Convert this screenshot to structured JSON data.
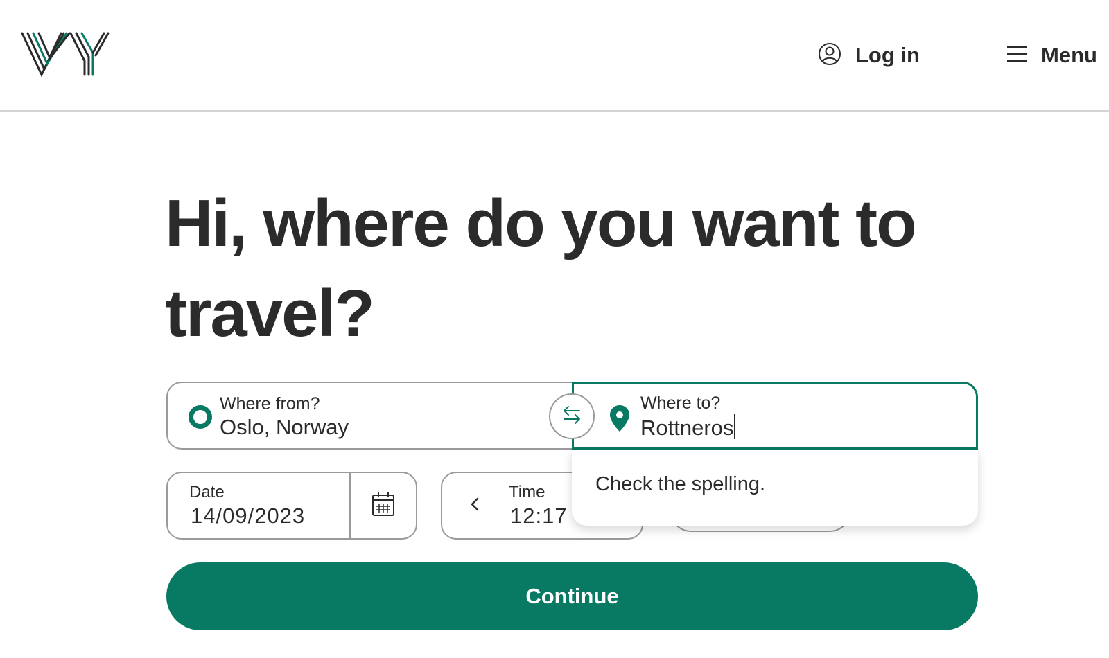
{
  "header": {
    "logo_icon": "vy-logo",
    "login_icon": "user-circle-icon",
    "login_label": "Log in",
    "menu_icon": "hamburger-icon",
    "menu_label": "Menu"
  },
  "main": {
    "headline": "Hi, where do you want to travel?"
  },
  "search": {
    "from_label": "Where from?",
    "from_value": "Oslo, Norway",
    "swap_icon": "swap-arrows-icon",
    "to_label": "Where to?",
    "to_value": "Rottneros",
    "suggestion_message": "Check the spelling."
  },
  "date": {
    "label": "Date",
    "value": "14/09/2023",
    "calendar_icon": "calendar-icon"
  },
  "time": {
    "label": "Time",
    "value": "12:17",
    "prev_icon": "chevron-left-icon"
  },
  "actions": {
    "continue_label": "Continue"
  },
  "colors": {
    "brand": "#087962",
    "text": "#2b2b2c",
    "border": "#9a9a9d"
  }
}
